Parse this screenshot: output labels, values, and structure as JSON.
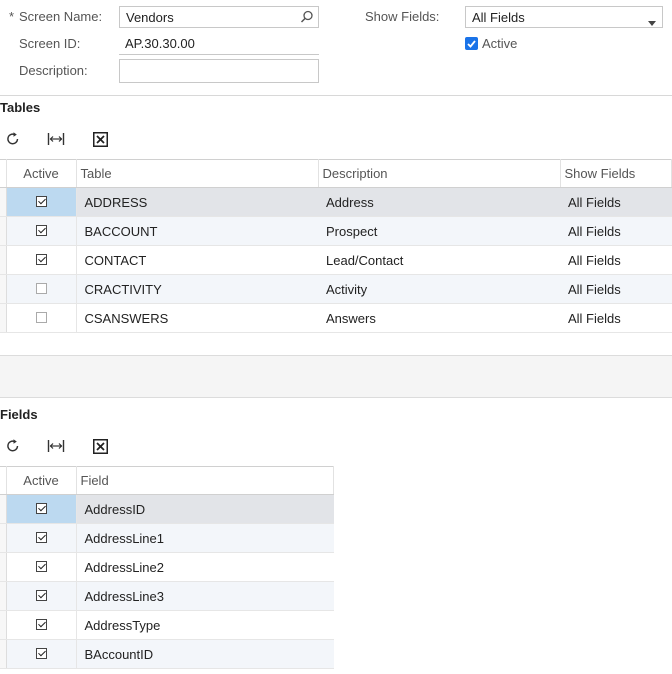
{
  "form": {
    "screen_name_label": "Screen Name:",
    "screen_name_required_mark": "*",
    "screen_name_value": "Vendors",
    "screen_id_label": "Screen ID:",
    "screen_id_value": "AP.30.30.00",
    "description_label": "Description:",
    "description_value": "",
    "show_fields_label": "Show Fields:",
    "show_fields_value": "All Fields",
    "active_label": "Active"
  },
  "tables_section": {
    "title": "Tables",
    "columns": {
      "active": "Active",
      "table": "Table",
      "description": "Description",
      "show_fields": "Show Fields"
    },
    "rows": [
      {
        "active": true,
        "table": "ADDRESS",
        "description": "Address",
        "show_fields": "All Fields"
      },
      {
        "active": true,
        "table": "BACCOUNT",
        "description": "Prospect",
        "show_fields": "All Fields"
      },
      {
        "active": true,
        "table": "CONTACT",
        "description": "Lead/Contact",
        "show_fields": "All Fields"
      },
      {
        "active": false,
        "table": "CRACTIVITY",
        "description": "Activity",
        "show_fields": "All Fields"
      },
      {
        "active": false,
        "table": "CSANSWERS",
        "description": "Answers",
        "show_fields": "All Fields"
      }
    ]
  },
  "fields_section": {
    "title": "Fields",
    "columns": {
      "active": "Active",
      "field": "Field"
    },
    "rows": [
      {
        "active": true,
        "field": "AddressID"
      },
      {
        "active": true,
        "field": "AddressLine1"
      },
      {
        "active": true,
        "field": "AddressLine2"
      },
      {
        "active": true,
        "field": "AddressLine3"
      },
      {
        "active": true,
        "field": "AddressType"
      },
      {
        "active": true,
        "field": "BAccountID"
      }
    ]
  },
  "icons": {
    "search": "search-icon",
    "dropdown": "chevron-down-icon",
    "refresh": "refresh-icon",
    "fit_width": "fit-width-icon",
    "export": "export-excel-icon"
  }
}
